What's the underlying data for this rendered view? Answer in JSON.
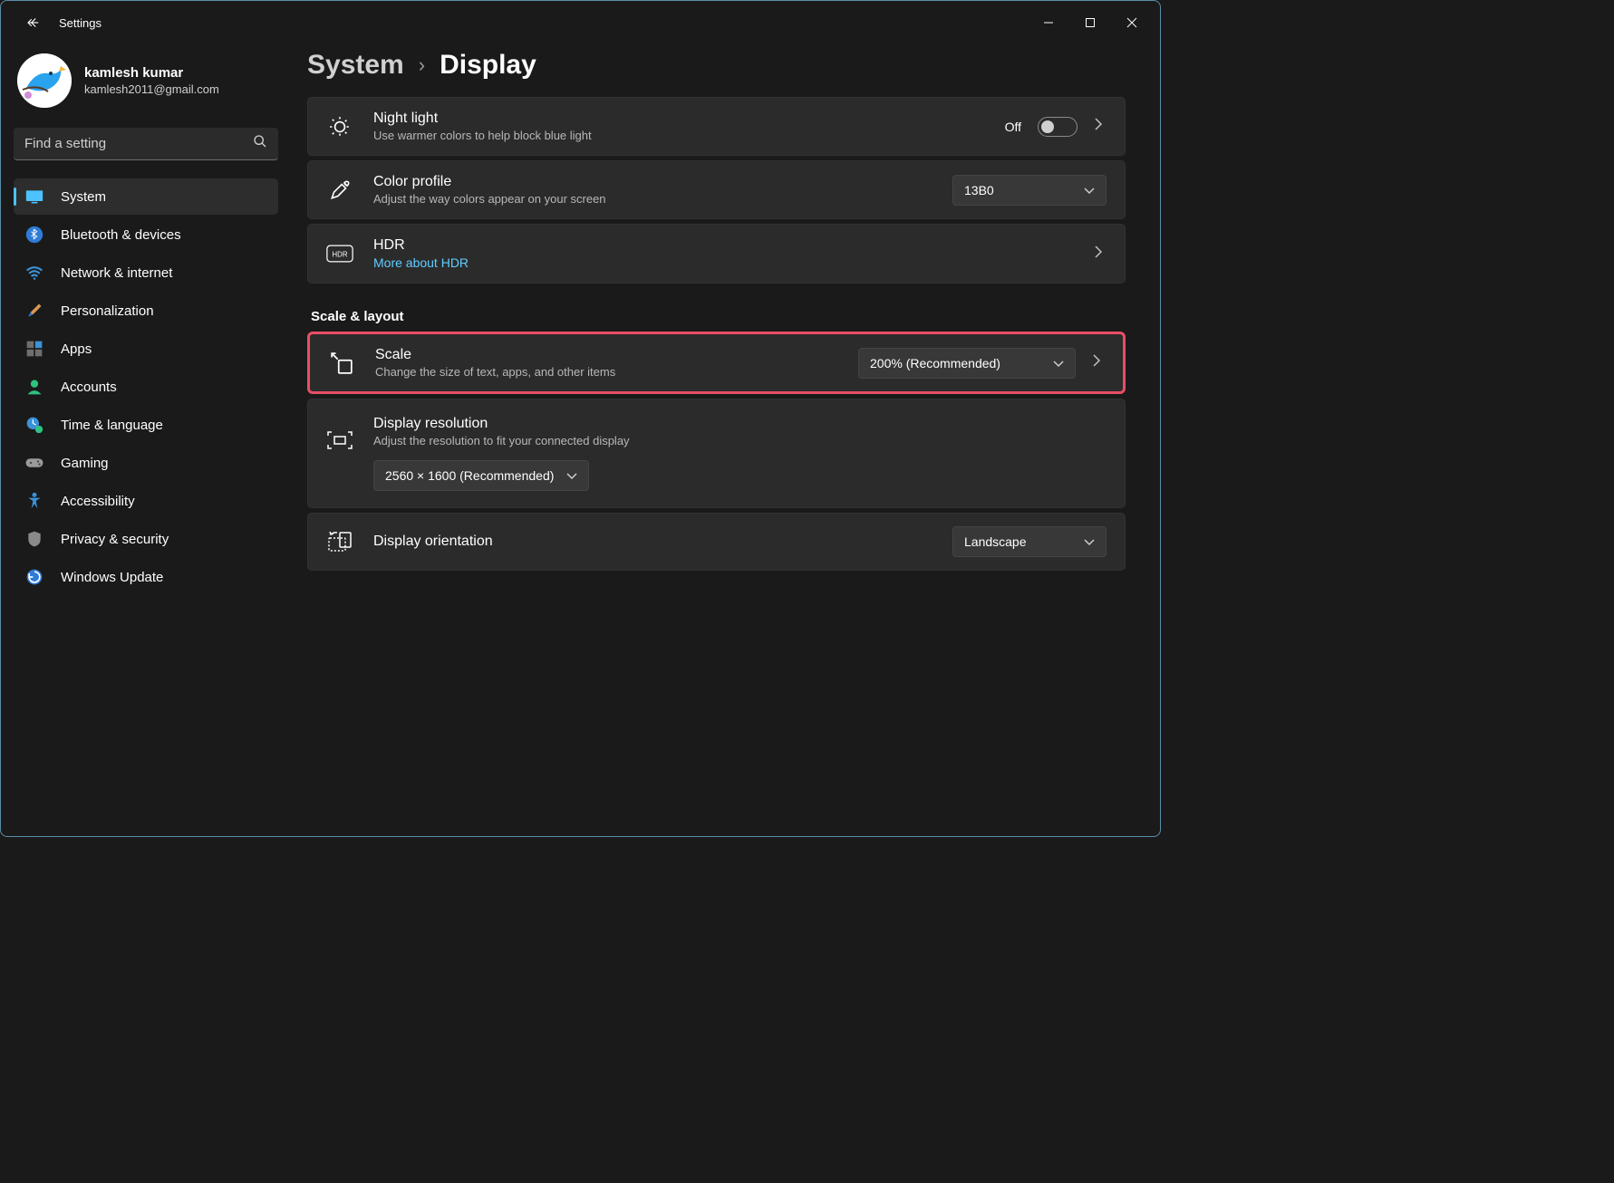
{
  "window": {
    "title": "Settings"
  },
  "profile": {
    "name": "kamlesh kumar",
    "email": "kamlesh2011@gmail.com"
  },
  "search": {
    "placeholder": "Find a setting"
  },
  "nav": {
    "items": [
      {
        "label": "System"
      },
      {
        "label": "Bluetooth & devices"
      },
      {
        "label": "Network & internet"
      },
      {
        "label": "Personalization"
      },
      {
        "label": "Apps"
      },
      {
        "label": "Accounts"
      },
      {
        "label": "Time & language"
      },
      {
        "label": "Gaming"
      },
      {
        "label": "Accessibility"
      },
      {
        "label": "Privacy & security"
      },
      {
        "label": "Windows Update"
      }
    ]
  },
  "breadcrumb": {
    "parent": "System",
    "current": "Display"
  },
  "night_light": {
    "title": "Night light",
    "sub": "Use warmer colors to help block blue light",
    "state_label": "Off"
  },
  "color_profile": {
    "title": "Color profile",
    "sub": "Adjust the way colors appear on your screen",
    "value": "13B0"
  },
  "hdr": {
    "title": "HDR",
    "link": "More about HDR"
  },
  "section_scale": "Scale & layout",
  "scale": {
    "title": "Scale",
    "sub": "Change the size of text, apps, and other items",
    "value": "200% (Recommended)"
  },
  "resolution": {
    "title": "Display resolution",
    "sub": "Adjust the resolution to fit your connected display",
    "value": "2560 × 1600 (Recommended)"
  },
  "orientation": {
    "title": "Display orientation",
    "value": "Landscape"
  }
}
